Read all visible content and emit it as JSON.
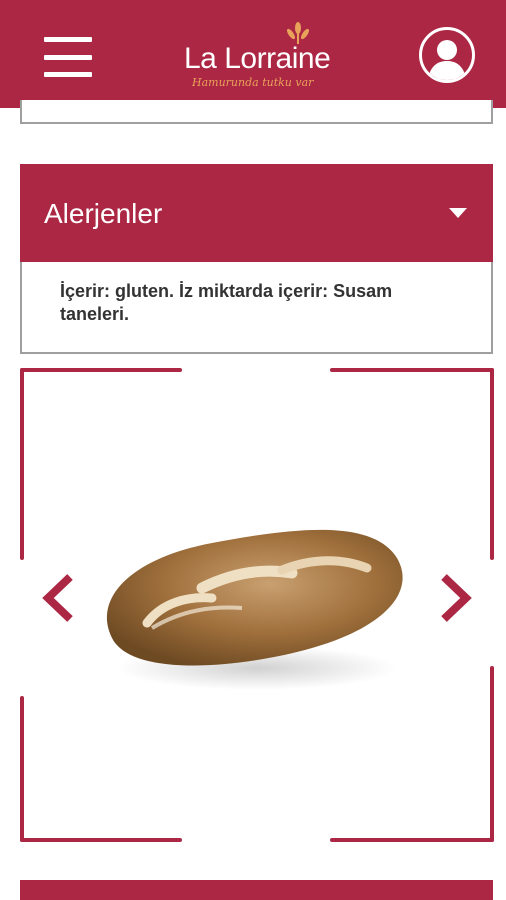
{
  "header": {
    "brand_name": "La Lorraine",
    "brand_tagline": "Hamurunda tutku var",
    "menu_icon": "hamburger-menu-icon",
    "profile_icon": "user-profile-icon"
  },
  "allergens": {
    "title": "Alerjenler",
    "expand_icon": "caret-down-icon",
    "text": "İçerir: gluten. İz miktarda içerir: Susam taneleri."
  },
  "carousel": {
    "image": "bread-loaf-photo",
    "prev_icon": "chevron-left-icon",
    "next_icon": "chevron-right-icon"
  },
  "colors": {
    "brand": "#ac2744",
    "card_border": "#9f9f9f",
    "text": "#333333",
    "tagline": "#e8a25a"
  }
}
